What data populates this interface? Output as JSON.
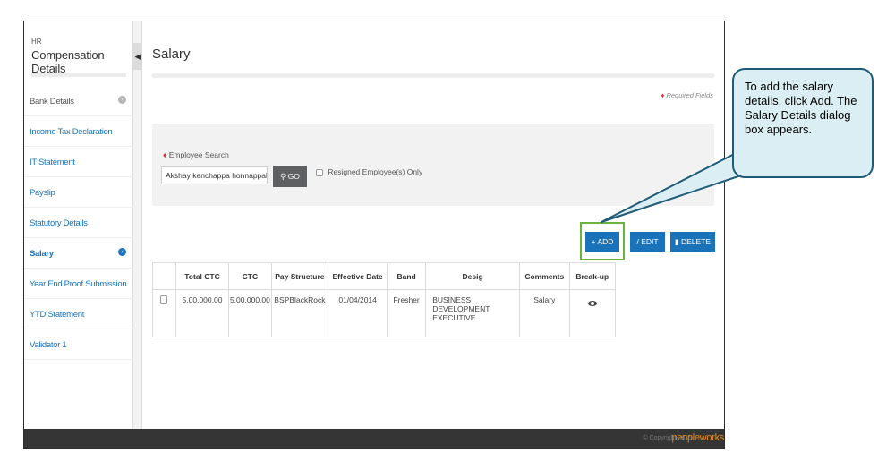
{
  "sidebar": {
    "section": "HR",
    "title": "Compensation Details",
    "items": [
      {
        "label": "Bank Details"
      },
      {
        "label": "Income Tax Declaration"
      },
      {
        "label": "IT Statement"
      },
      {
        "label": "Payslip"
      },
      {
        "label": "Statutory Details"
      },
      {
        "label": "Salary"
      },
      {
        "label": "Year End Proof Submission"
      },
      {
        "label": "YTD Statement"
      },
      {
        "label": "Validator 1"
      }
    ]
  },
  "page": {
    "title": "Salary",
    "required_note": "Required Fields"
  },
  "search": {
    "label": "Employee Search",
    "value": "Akshay kenchappa honnappakenc",
    "go_label": "GO",
    "resigned_label": "Resigned Employee(s) Only"
  },
  "actions": {
    "add": "ADD",
    "edit": "EDIT",
    "delete": "DELETE"
  },
  "table": {
    "headers": [
      "Total CTC",
      "CTC",
      "Pay Structure",
      "Effective Date",
      "Band",
      "Desig",
      "Comments",
      "Break-up"
    ],
    "rows": [
      {
        "total_ctc": "5,00,000.00",
        "ctc": "5,00,000.00",
        "pay_structure": "BSPBlackRock",
        "effective_date": "01/04/2014",
        "band": "Fresher",
        "desig": "BUSINESS DEVELOPMENT EXECUTIVE",
        "comments": "Salary"
      }
    ]
  },
  "footer": {
    "copyright": "© Copyright 2015",
    "logo": "peopleworks"
  },
  "callout": {
    "text": "To add the salary details, click Add. The Salary Details dialog box appears."
  },
  "colors": {
    "accent": "#1a73b8",
    "highlight": "#6ab23c",
    "footer_bg": "#353535",
    "callout_bg": "#daeef3",
    "callout_border": "#1f5b77"
  }
}
